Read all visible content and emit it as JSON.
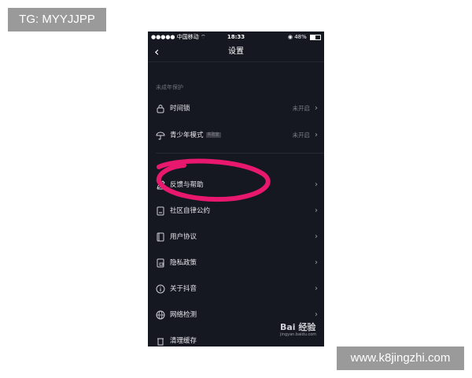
{
  "watermarks": {
    "top_left": "TG: MYYJJPP",
    "bottom_right": "www.k8jingzhi.com"
  },
  "status_bar": {
    "carrier": "●●●●● 中国移动",
    "time": "18:33",
    "battery": "48%"
  },
  "nav": {
    "back_icon": "chevron-left-icon",
    "title": "设置"
  },
  "section": {
    "label": "未成年保护"
  },
  "items": [
    {
      "label": "时间锁",
      "value": "未开启",
      "icon": "lock-icon"
    },
    {
      "label": "青少年模式",
      "badge": "实验室",
      "value": "未开启",
      "icon": "umbrella-icon"
    },
    {
      "label": "反馈与帮助",
      "value": "",
      "icon": "edit-icon"
    },
    {
      "label": "社区自律公约",
      "value": "",
      "icon": "document-icon"
    },
    {
      "label": "用户协议",
      "value": "",
      "icon": "book-icon"
    },
    {
      "label": "隐私政策",
      "value": "",
      "icon": "privacy-doc-icon"
    },
    {
      "label": "关于抖音",
      "value": "",
      "icon": "info-icon"
    },
    {
      "label": "网络检测",
      "value": "",
      "icon": "globe-icon"
    },
    {
      "label": "清理缓存",
      "value": "",
      "icon": "trash-icon"
    }
  ],
  "baidu": {
    "logo": "Bai 经验",
    "sub": "jingyan.baidu.com"
  },
  "colors": {
    "background": "#161821",
    "highlight_mark": "#e8186e"
  }
}
